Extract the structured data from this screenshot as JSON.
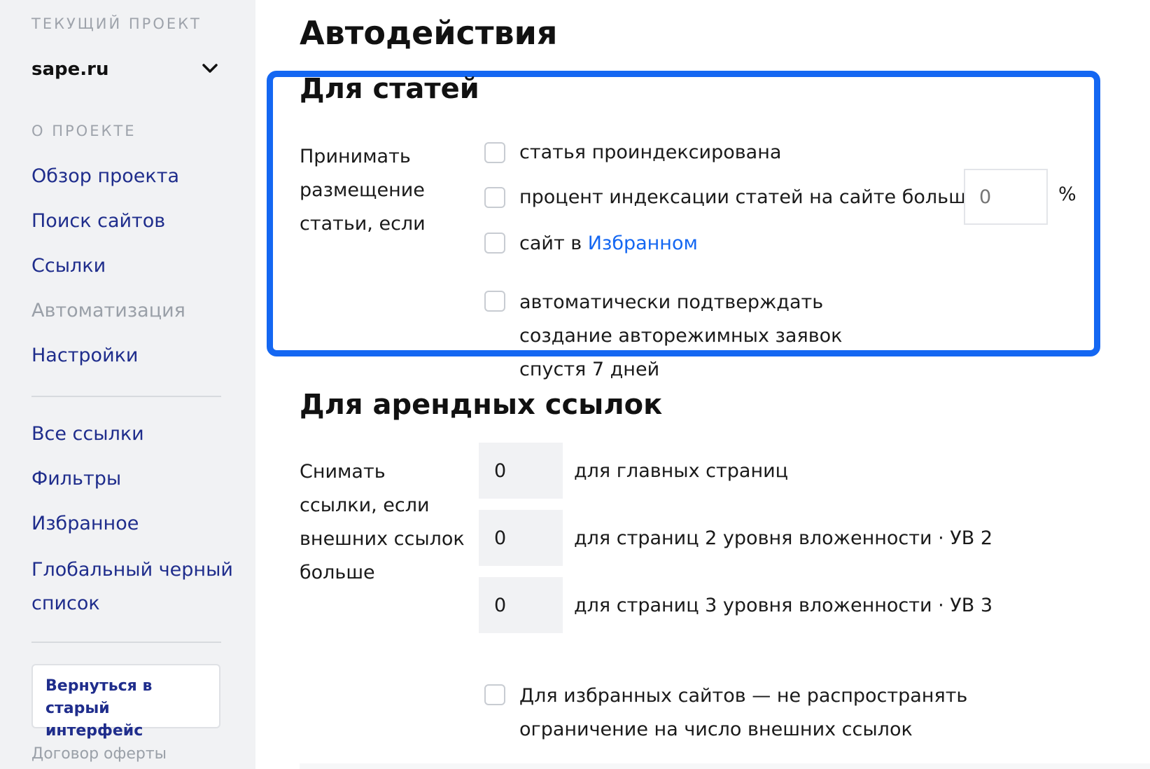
{
  "sidebar": {
    "current_project_caption": "ТЕКУЩИЙ ПРОЕКТ",
    "project_name": "sape.ru",
    "about_caption": "О ПРОЕКТЕ",
    "nav_items": [
      {
        "label": "Обзор проекта"
      },
      {
        "label": "Поиск сайтов"
      },
      {
        "label": "Ссылки"
      },
      {
        "label": "Автоматизация",
        "active": true
      },
      {
        "label": "Настройки"
      }
    ],
    "link_items": [
      {
        "label": "Все ссылки"
      },
      {
        "label": "Фильтры"
      },
      {
        "label": "Избранное"
      },
      {
        "label": "Глобальный черный список"
      }
    ],
    "old_interface_button": "Вернуться в старый интерфейс",
    "offer_link": "Договор оферты"
  },
  "main": {
    "title": "Автодействия",
    "articles": {
      "title": "Для статей",
      "label": "Принимать размещение статьи, если",
      "options": {
        "indexed": "статья проиндексирована",
        "index_percent": "процент индексации статей на сайте больше",
        "favorites_prefix": "сайт в",
        "favorites_link": "Избранном",
        "auto_confirm": "автоматически подтверждать создание авторежимных заявок спустя 7 дней"
      },
      "percent_placeholder": "0",
      "percent_sign": "%"
    },
    "rental": {
      "title": "Для арендных ссылок",
      "label": "Снимать ссылки, если внешних ссылок больше",
      "rows": [
        {
          "value": "0",
          "label": "для главных страниц"
        },
        {
          "value": "0",
          "label": "для страниц 2 уровня вложенности · УВ 2"
        },
        {
          "value": "0",
          "label": "для страниц 3 уровня вложенности · УВ 3"
        }
      ],
      "favorites_option": "Для избранных сайтов — не распространять ограничение на число внешних ссылок"
    }
  },
  "colors": {
    "accent": "#1467f2",
    "nav_link": "#1f2d8c",
    "sidebar_bg": "#f1f2f4"
  }
}
